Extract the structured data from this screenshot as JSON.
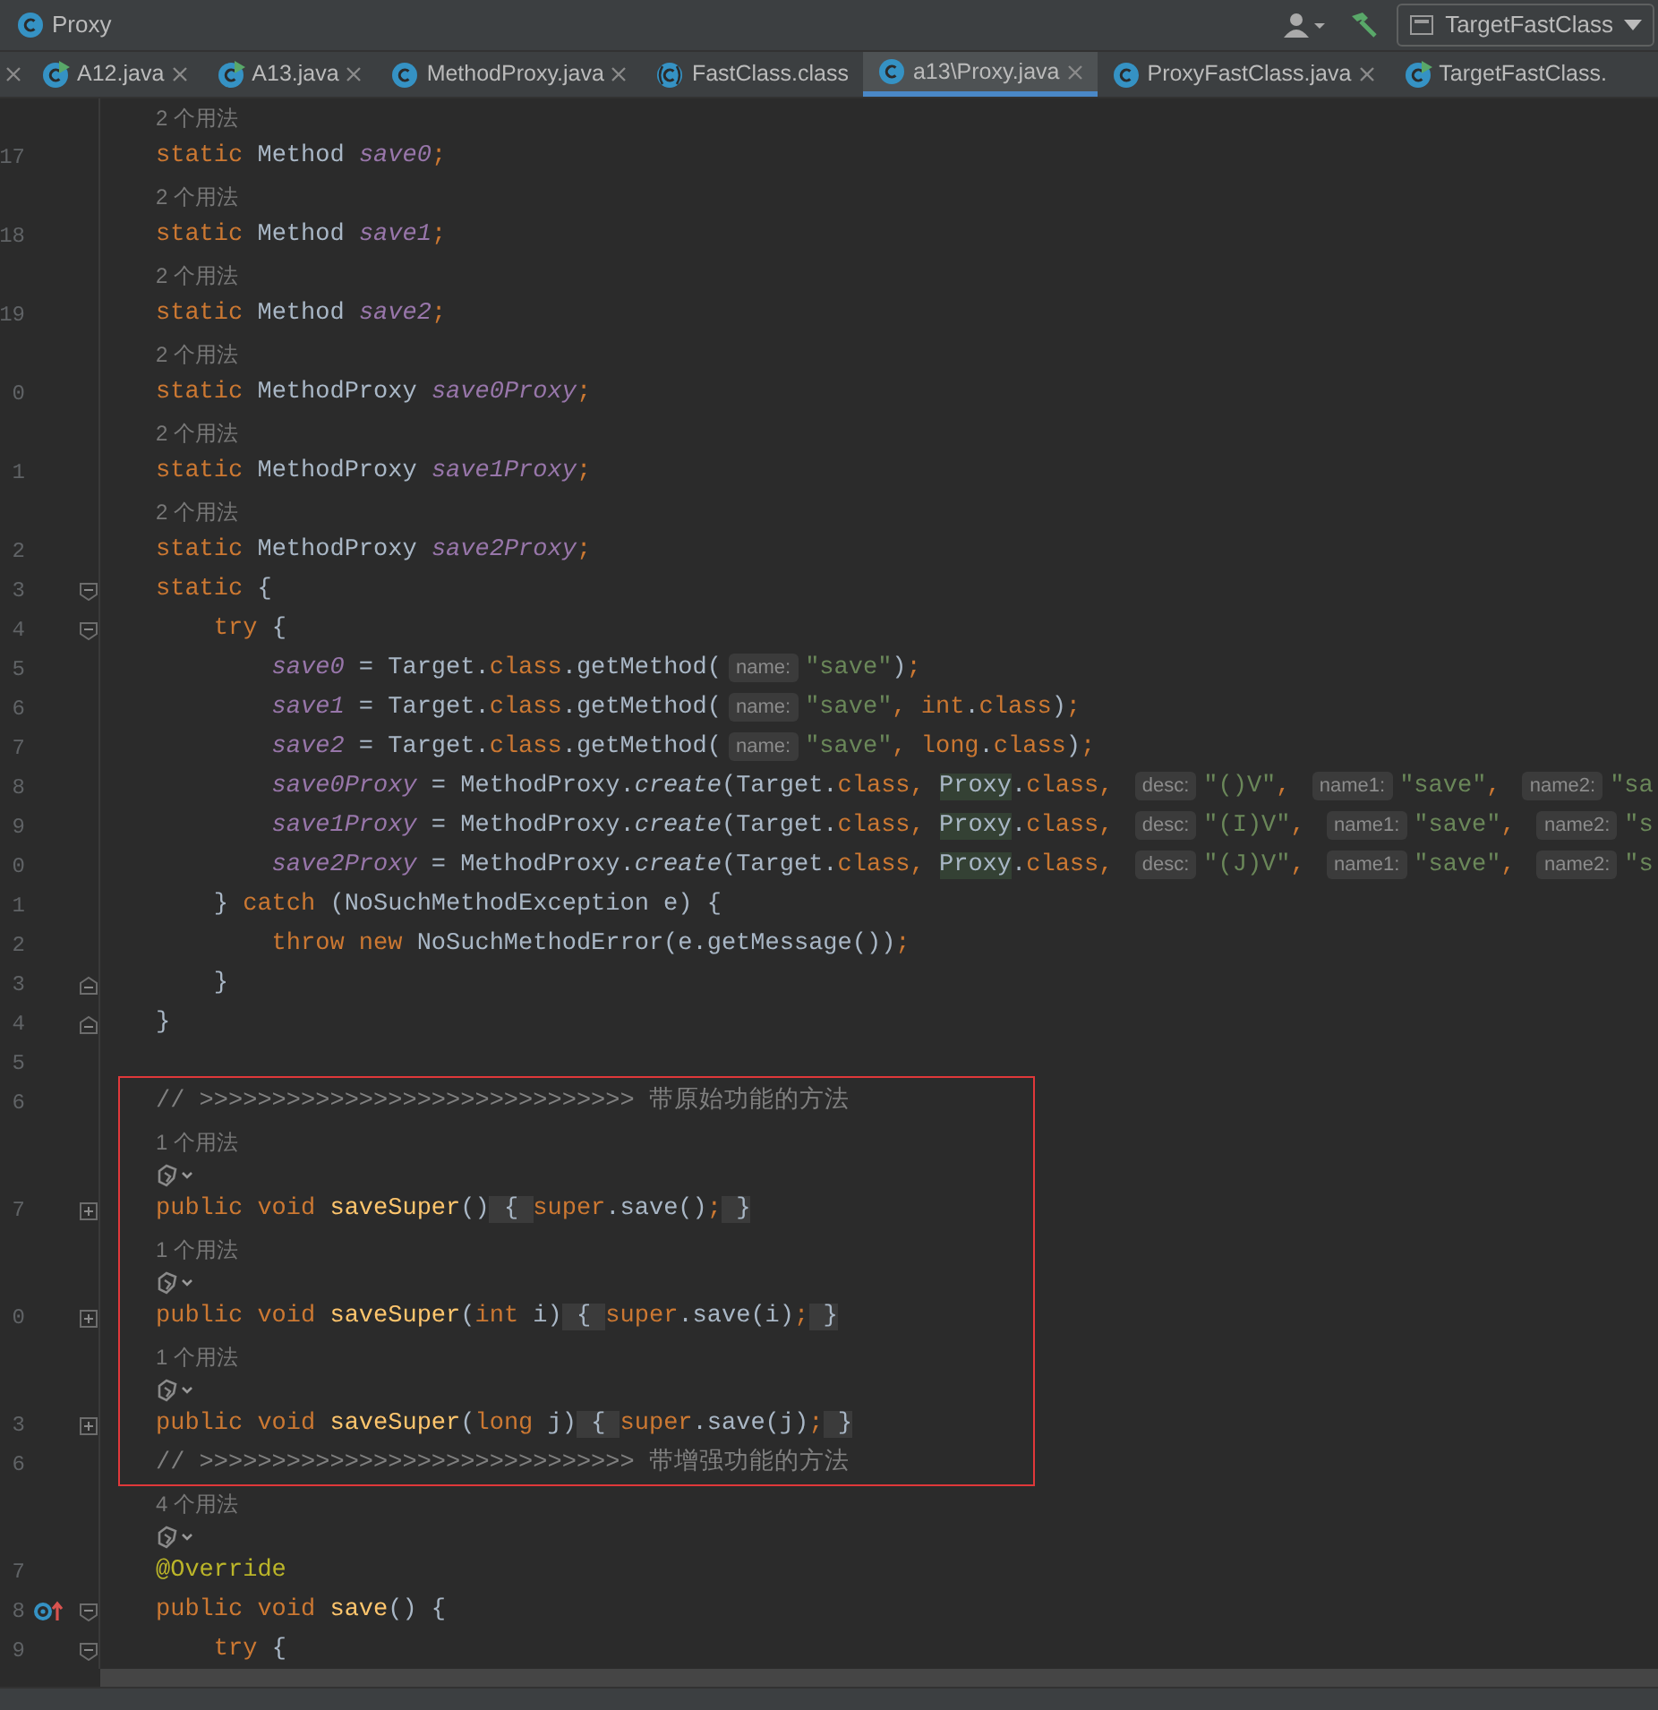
{
  "navbar": {
    "breadcrumb": "Proxy",
    "run_config": "TargetFastClass"
  },
  "tabs": [
    {
      "kind": "fragment",
      "closable": true,
      "selected": false
    },
    {
      "label": "A12.java",
      "kind": "runnable",
      "closable": true,
      "selected": false
    },
    {
      "label": "A13.java",
      "kind": "runnable",
      "closable": true,
      "selected": false
    },
    {
      "label": "MethodProxy.java",
      "kind": "source",
      "closable": true,
      "selected": false
    },
    {
      "label": "FastClass.class",
      "kind": "compiled",
      "closable": false,
      "selected": false
    },
    {
      "label": "a13\\Proxy.java",
      "kind": "source",
      "closable": true,
      "selected": true
    },
    {
      "label": "ProxyFastClass.java",
      "kind": "source",
      "closable": true,
      "selected": false
    },
    {
      "label": "TargetFastClass.",
      "kind": "runnable",
      "closable": false,
      "selected": false
    }
  ],
  "editor": {
    "rows": [
      {
        "kind": "hint",
        "text": "2 个用法"
      },
      {
        "kind": "code",
        "number": "17",
        "tokens": [
          {
            "text": "static ",
            "kind": "kw"
          },
          {
            "text": "Method ",
            "kind": "plain"
          },
          {
            "text": "save0",
            "kind": "field"
          },
          {
            "text": ";",
            "kind": "kw"
          }
        ]
      },
      {
        "kind": "hint",
        "text": "2 个用法"
      },
      {
        "kind": "code",
        "number": "18",
        "tokens": [
          {
            "text": "static ",
            "kind": "kw"
          },
          {
            "text": "Method ",
            "kind": "plain"
          },
          {
            "text": "save1",
            "kind": "field"
          },
          {
            "text": ";",
            "kind": "kw"
          }
        ]
      },
      {
        "kind": "hint",
        "text": "2 个用法"
      },
      {
        "kind": "code",
        "number": "19",
        "tokens": [
          {
            "text": "static ",
            "kind": "kw"
          },
          {
            "text": "Method ",
            "kind": "plain"
          },
          {
            "text": "save2",
            "kind": "field"
          },
          {
            "text": ";",
            "kind": "kw"
          }
        ]
      },
      {
        "kind": "hint",
        "text": "2 个用法"
      },
      {
        "kind": "code",
        "number": "0",
        "tokens": [
          {
            "text": "static ",
            "kind": "kw"
          },
          {
            "text": "MethodProxy ",
            "kind": "plain"
          },
          {
            "text": "save0Proxy",
            "kind": "field"
          },
          {
            "text": ";",
            "kind": "kw"
          }
        ]
      },
      {
        "kind": "hint",
        "text": "2 个用法"
      },
      {
        "kind": "code",
        "number": "1",
        "tokens": [
          {
            "text": "static ",
            "kind": "kw"
          },
          {
            "text": "MethodProxy ",
            "kind": "plain"
          },
          {
            "text": "save1Proxy",
            "kind": "field"
          },
          {
            "text": ";",
            "kind": "kw"
          }
        ]
      },
      {
        "kind": "hint",
        "text": "2 个用法"
      },
      {
        "kind": "code",
        "number": "2",
        "tokens": [
          {
            "text": "static ",
            "kind": "kw"
          },
          {
            "text": "MethodProxy ",
            "kind": "plain"
          },
          {
            "text": "save2Proxy",
            "kind": "field"
          },
          {
            "text": ";",
            "kind": "kw"
          }
        ]
      },
      {
        "kind": "code",
        "number": "3",
        "fold_start": true,
        "tokens": [
          {
            "text": "static ",
            "kind": "kw"
          },
          {
            "text": "{",
            "kind": "plain"
          }
        ]
      },
      {
        "kind": "code",
        "number": "4",
        "fold_start": true,
        "tokens": [
          {
            "text": "    try ",
            "kind": "kw"
          },
          {
            "text": "{",
            "kind": "plain"
          }
        ]
      },
      {
        "kind": "code",
        "number": "5",
        "tokens": [
          {
            "text": "        save0",
            "kind": "field"
          },
          {
            "text": " = Target.",
            "kind": "plain"
          },
          {
            "text": "class",
            "kind": "kw"
          },
          {
            "text": ".getMethod(",
            "kind": "plain"
          },
          {
            "text": "name:",
            "kind": "inlay"
          },
          {
            "text": "\"save\"",
            "kind": "str"
          },
          {
            "text": ")",
            "kind": "plain"
          },
          {
            "text": ";",
            "kind": "kw"
          }
        ]
      },
      {
        "kind": "code",
        "number": "6",
        "tokens": [
          {
            "text": "        save1",
            "kind": "field"
          },
          {
            "text": " = Target.",
            "kind": "plain"
          },
          {
            "text": "class",
            "kind": "kw"
          },
          {
            "text": ".getMethod(",
            "kind": "plain"
          },
          {
            "text": "name:",
            "kind": "inlay"
          },
          {
            "text": "\"save\"",
            "kind": "str"
          },
          {
            "text": ", int",
            "kind": "kw"
          },
          {
            "text": ".",
            "kind": "plain"
          },
          {
            "text": "class",
            "kind": "kw"
          },
          {
            "text": ")",
            "kind": "plain"
          },
          {
            "text": ";",
            "kind": "kw"
          }
        ]
      },
      {
        "kind": "code",
        "number": "7",
        "tokens": [
          {
            "text": "        save2",
            "kind": "field"
          },
          {
            "text": " = Target.",
            "kind": "plain"
          },
          {
            "text": "class",
            "kind": "kw"
          },
          {
            "text": ".getMethod(",
            "kind": "plain"
          },
          {
            "text": "name:",
            "kind": "inlay"
          },
          {
            "text": "\"save\"",
            "kind": "str"
          },
          {
            "text": ", long",
            "kind": "kw"
          },
          {
            "text": ".",
            "kind": "plain"
          },
          {
            "text": "class",
            "kind": "kw"
          },
          {
            "text": ")",
            "kind": "plain"
          },
          {
            "text": ";",
            "kind": "kw"
          }
        ]
      },
      {
        "kind": "code",
        "number": "8",
        "tokens": [
          {
            "text": "        save0Proxy",
            "kind": "field"
          },
          {
            "text": " = MethodProxy.",
            "kind": "plain"
          },
          {
            "text": "create",
            "kind": "static"
          },
          {
            "text": "(Target.",
            "kind": "plain"
          },
          {
            "text": "class",
            "kind": "kw"
          },
          {
            "text": ", ",
            "kind": "kw"
          },
          {
            "text": "Proxy",
            "kind": "match"
          },
          {
            "text": ".",
            "kind": "plain"
          },
          {
            "text": "class",
            "kind": "kw"
          },
          {
            "text": ", ",
            "kind": "kw"
          },
          {
            "text": "desc:",
            "kind": "inlay"
          },
          {
            "text": "\"()V\"",
            "kind": "str"
          },
          {
            "text": ", ",
            "kind": "kw"
          },
          {
            "text": "name1:",
            "kind": "inlay"
          },
          {
            "text": "\"save\"",
            "kind": "str"
          },
          {
            "text": ", ",
            "kind": "kw"
          },
          {
            "text": "name2:",
            "kind": "inlay"
          },
          {
            "text": "\"sa",
            "kind": "str"
          }
        ]
      },
      {
        "kind": "code",
        "number": "9",
        "tokens": [
          {
            "text": "        save1Proxy",
            "kind": "field"
          },
          {
            "text": " = MethodProxy.",
            "kind": "plain"
          },
          {
            "text": "create",
            "kind": "static"
          },
          {
            "text": "(Target.",
            "kind": "plain"
          },
          {
            "text": "class",
            "kind": "kw"
          },
          {
            "text": ", ",
            "kind": "kw"
          },
          {
            "text": "Proxy",
            "kind": "match"
          },
          {
            "text": ".",
            "kind": "plain"
          },
          {
            "text": "class",
            "kind": "kw"
          },
          {
            "text": ", ",
            "kind": "kw"
          },
          {
            "text": "desc:",
            "kind": "inlay"
          },
          {
            "text": "\"(I)V\"",
            "kind": "str"
          },
          {
            "text": ", ",
            "kind": "kw"
          },
          {
            "text": "name1:",
            "kind": "inlay"
          },
          {
            "text": "\"save\"",
            "kind": "str"
          },
          {
            "text": ", ",
            "kind": "kw"
          },
          {
            "text": "name2:",
            "kind": "inlay"
          },
          {
            "text": "\"s",
            "kind": "str"
          }
        ]
      },
      {
        "kind": "code",
        "number": "0",
        "tokens": [
          {
            "text": "        save2Proxy",
            "kind": "field"
          },
          {
            "text": " = MethodProxy.",
            "kind": "plain"
          },
          {
            "text": "create",
            "kind": "static"
          },
          {
            "text": "(Target.",
            "kind": "plain"
          },
          {
            "text": "class",
            "kind": "kw"
          },
          {
            "text": ", ",
            "kind": "kw"
          },
          {
            "text": "Proxy",
            "kind": "match"
          },
          {
            "text": ".",
            "kind": "plain"
          },
          {
            "text": "class",
            "kind": "kw"
          },
          {
            "text": ", ",
            "kind": "kw"
          },
          {
            "text": "desc:",
            "kind": "inlay"
          },
          {
            "text": "\"(J)V\"",
            "kind": "str"
          },
          {
            "text": ", ",
            "kind": "kw"
          },
          {
            "text": "name1:",
            "kind": "inlay"
          },
          {
            "text": "\"save\"",
            "kind": "str"
          },
          {
            "text": ", ",
            "kind": "kw"
          },
          {
            "text": "name2:",
            "kind": "inlay"
          },
          {
            "text": "\"s",
            "kind": "str"
          }
        ]
      },
      {
        "kind": "code",
        "number": "1",
        "tokens": [
          {
            "text": "    } ",
            "kind": "plain"
          },
          {
            "text": "catch ",
            "kind": "kw"
          },
          {
            "text": "(NoSuchMethodException e) {",
            "kind": "plain"
          }
        ]
      },
      {
        "kind": "code",
        "number": "2",
        "tokens": [
          {
            "text": "        throw new ",
            "kind": "kw"
          },
          {
            "text": "NoSuchMethodError(e.getMessage())",
            "kind": "plain"
          },
          {
            "text": ";",
            "kind": "kw"
          }
        ]
      },
      {
        "kind": "code",
        "number": "3",
        "fold_end": true,
        "tokens": [
          {
            "text": "    }",
            "kind": "plain"
          }
        ]
      },
      {
        "kind": "code",
        "number": "4",
        "fold_end": true,
        "tokens": [
          {
            "text": "}",
            "kind": "plain"
          }
        ]
      },
      {
        "kind": "code",
        "number": "5",
        "tokens": []
      },
      {
        "kind": "code",
        "number": "6",
        "tokens": [
          {
            "text": "// >>>>>>>>>>>>>>>>>>>>>>>>>>>>>> 带原始功能的方法",
            "kind": "comment"
          }
        ]
      },
      {
        "kind": "hint",
        "text": "1 个用法"
      },
      {
        "kind": "vision"
      },
      {
        "kind": "code",
        "number": "7",
        "collapsed": true,
        "tokens": [
          {
            "text": "public void ",
            "kind": "kw"
          },
          {
            "text": "saveSuper",
            "kind": "decl"
          },
          {
            "text": "()",
            "kind": "plain"
          },
          {
            "text": " { ",
            "kind": "folded"
          },
          {
            "text": "super",
            "kind": "kw"
          },
          {
            "text": ".save()",
            "kind": "plain"
          },
          {
            "text": ";",
            "kind": "kw"
          },
          {
            "text": " }",
            "kind": "folded"
          }
        ]
      },
      {
        "kind": "hint",
        "text": "1 个用法"
      },
      {
        "kind": "vision"
      },
      {
        "kind": "code",
        "number": "0",
        "collapsed": true,
        "tokens": [
          {
            "text": "public void ",
            "kind": "kw"
          },
          {
            "text": "saveSuper",
            "kind": "decl"
          },
          {
            "text": "(",
            "kind": "plain"
          },
          {
            "text": "int ",
            "kind": "kw"
          },
          {
            "text": "i)",
            "kind": "plain"
          },
          {
            "text": " { ",
            "kind": "folded"
          },
          {
            "text": "super",
            "kind": "kw"
          },
          {
            "text": ".save(i)",
            "kind": "plain"
          },
          {
            "text": ";",
            "kind": "kw"
          },
          {
            "text": " }",
            "kind": "folded"
          }
        ]
      },
      {
        "kind": "hint",
        "text": "1 个用法"
      },
      {
        "kind": "vision"
      },
      {
        "kind": "code",
        "number": "3",
        "collapsed": true,
        "tokens": [
          {
            "text": "public void ",
            "kind": "kw"
          },
          {
            "text": "saveSuper",
            "kind": "decl"
          },
          {
            "text": "(",
            "kind": "plain"
          },
          {
            "text": "long ",
            "kind": "kw"
          },
          {
            "text": "j)",
            "kind": "plain"
          },
          {
            "text": " { ",
            "kind": "folded"
          },
          {
            "text": "super",
            "kind": "kw"
          },
          {
            "text": ".save(j)",
            "kind": "plain"
          },
          {
            "text": ";",
            "kind": "kw"
          },
          {
            "text": " }",
            "kind": "folded"
          }
        ]
      },
      {
        "kind": "code",
        "number": "6",
        "tokens": [
          {
            "text": "// >>>>>>>>>>>>>>>>>>>>>>>>>>>>>> 带增强功能的方法",
            "kind": "comment"
          }
        ]
      },
      {
        "kind": "hint",
        "text": "4 个用法"
      },
      {
        "kind": "vision"
      },
      {
        "kind": "code",
        "number": "7",
        "tokens": [
          {
            "text": "@Override",
            "kind": "annot"
          }
        ]
      },
      {
        "kind": "code",
        "number": "8",
        "fold_start": true,
        "override_marker": true,
        "tokens": [
          {
            "text": "public void ",
            "kind": "kw"
          },
          {
            "text": "save",
            "kind": "decl"
          },
          {
            "text": "() {",
            "kind": "plain"
          }
        ]
      },
      {
        "kind": "code",
        "number": "9",
        "fold_start": true,
        "tokens": [
          {
            "text": "    try ",
            "kind": "kw"
          },
          {
            "text": "{",
            "kind": "plain"
          }
        ]
      }
    ]
  }
}
